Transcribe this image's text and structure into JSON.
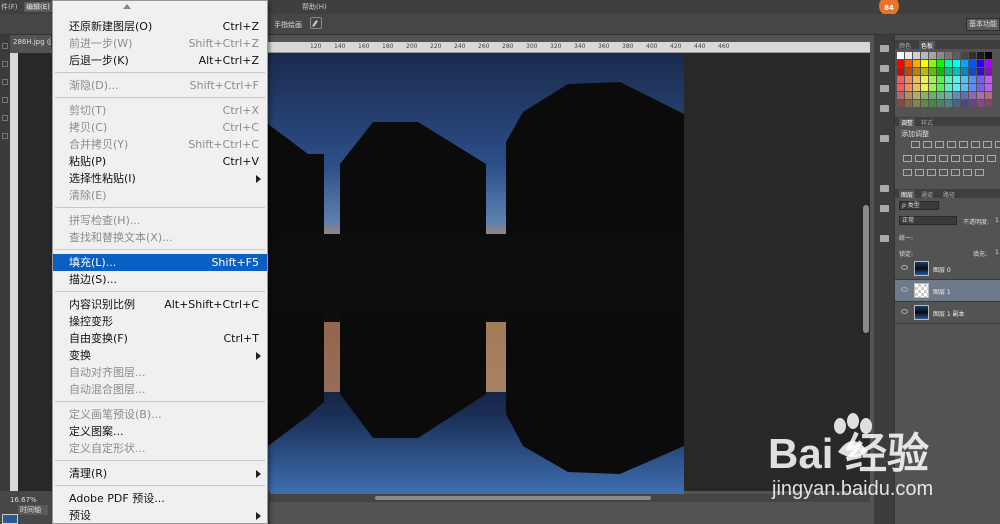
{
  "menubar": {
    "file": "件(F)",
    "edit": "编辑(E)",
    "help": "帮助(H)",
    "badge": "84"
  },
  "options": {
    "hand_label": "手指绘画",
    "workspace": "基本功能"
  },
  "document": {
    "tab": "286H.jpg @"
  },
  "ruler": {
    "ticks": [
      "120",
      "140",
      "160",
      "180",
      "200",
      "220",
      "240",
      "260",
      "280",
      "300",
      "320",
      "340",
      "360",
      "380",
      "400",
      "420",
      "440",
      "460"
    ]
  },
  "status": {
    "zoom": "16.67%",
    "timeline": "时间轴"
  },
  "edit_menu": {
    "items": [
      {
        "label": "还原新建图层(O)",
        "shortcut": "Ctrl+Z",
        "disabled": false,
        "sep_after": false
      },
      {
        "label": "前进一步(W)",
        "shortcut": "Shift+Ctrl+Z",
        "disabled": true,
        "sep_after": false
      },
      {
        "label": "后退一步(K)",
        "shortcut": "Alt+Ctrl+Z",
        "disabled": false,
        "sep_after": true
      },
      {
        "label": "渐隐(D)...",
        "shortcut": "Shift+Ctrl+F",
        "disabled": true,
        "sep_after": true
      },
      {
        "label": "剪切(T)",
        "shortcut": "Ctrl+X",
        "disabled": true,
        "sep_after": false
      },
      {
        "label": "拷贝(C)",
        "shortcut": "Ctrl+C",
        "disabled": true,
        "sep_after": false
      },
      {
        "label": "合并拷贝(Y)",
        "shortcut": "Shift+Ctrl+C",
        "disabled": true,
        "sep_after": false
      },
      {
        "label": "粘贴(P)",
        "shortcut": "Ctrl+V",
        "disabled": false,
        "sep_after": false
      },
      {
        "label": "选择性粘贴(I)",
        "shortcut": "",
        "disabled": false,
        "submenu": true,
        "sep_after": false
      },
      {
        "label": "清除(E)",
        "shortcut": "",
        "disabled": true,
        "sep_after": true
      },
      {
        "label": "拼写检查(H)...",
        "shortcut": "",
        "disabled": true,
        "sep_after": false
      },
      {
        "label": "查找和替换文本(X)...",
        "shortcut": "",
        "disabled": true,
        "sep_after": true
      },
      {
        "label": "填充(L)...",
        "shortcut": "Shift+F5",
        "disabled": false,
        "highlighted": true,
        "sep_after": false
      },
      {
        "label": "描边(S)...",
        "shortcut": "",
        "disabled": false,
        "sep_after": true
      },
      {
        "label": "内容识别比例",
        "shortcut": "Alt+Shift+Ctrl+C",
        "disabled": false,
        "sep_after": false
      },
      {
        "label": "操控变形",
        "shortcut": "",
        "disabled": false,
        "sep_after": false
      },
      {
        "label": "自由变换(F)",
        "shortcut": "Ctrl+T",
        "disabled": false,
        "sep_after": false
      },
      {
        "label": "变换",
        "shortcut": "",
        "disabled": false,
        "submenu": true,
        "sep_after": false
      },
      {
        "label": "自动对齐图层...",
        "shortcut": "",
        "disabled": true,
        "sep_after": false
      },
      {
        "label": "自动混合图层...",
        "shortcut": "",
        "disabled": true,
        "sep_after": true
      },
      {
        "label": "定义画笔预设(B)...",
        "shortcut": "",
        "disabled": true,
        "sep_after": false
      },
      {
        "label": "定义图案...",
        "shortcut": "",
        "disabled": false,
        "sep_after": false
      },
      {
        "label": "定义自定形状...",
        "shortcut": "",
        "disabled": true,
        "sep_after": true
      },
      {
        "label": "清理(R)",
        "shortcut": "",
        "disabled": false,
        "submenu": true,
        "sep_after": true
      },
      {
        "label": "Adobe PDF 预设...",
        "shortcut": "",
        "disabled": false,
        "sep_after": false
      },
      {
        "label": "预设",
        "shortcut": "",
        "disabled": false,
        "submenu": true,
        "sep_after": false
      }
    ]
  },
  "panels": {
    "color_tabs": [
      "颜色",
      "色板"
    ],
    "adj_tabs": [
      "调整",
      "样式"
    ],
    "adj_title": "添加调整",
    "layer_tabs": [
      "图层",
      "通道",
      "路径"
    ],
    "kind": "ρ 类型",
    "blend": "正常",
    "opacity_label": "不透明度:",
    "opacity_value": "1",
    "lock_label": "锁定:",
    "fill_label": "填充:",
    "fill_value": "1",
    "unify_label": "统一:",
    "layers": [
      {
        "name": "图层 0",
        "selected": false
      },
      {
        "name": "图层 1",
        "selected": true
      },
      {
        "name": "图层 1 副本",
        "selected": false
      }
    ]
  },
  "watermark": {
    "logo": "Bai 经验",
    "url": "jingyan.baidu.com"
  }
}
